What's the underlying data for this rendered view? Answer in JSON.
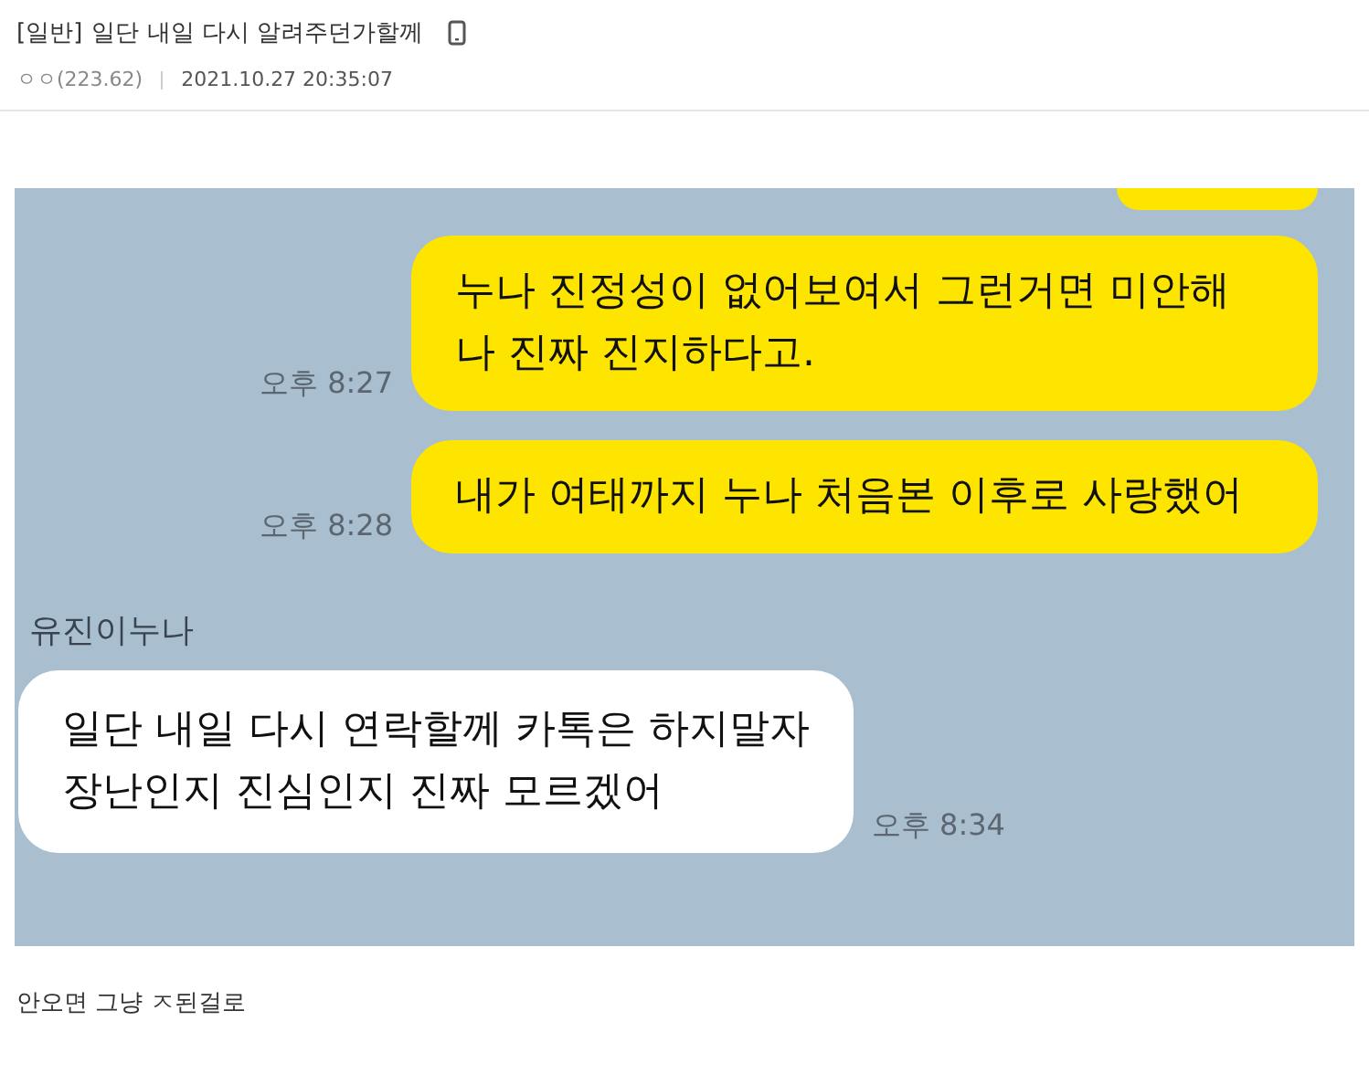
{
  "post": {
    "category": "[일반]",
    "title": "일단 내일 다시 알려주던가할께",
    "author": "ㅇㅇ(223.62)",
    "date": "2021.10.27 20:35:07"
  },
  "chat": {
    "messages": [
      {
        "kind": "partial",
        "mine": true
      },
      {
        "kind": "text",
        "mine": true,
        "lines": [
          "누나 진정성이 없어보여서 그런거면 미안해",
          "나 진짜 진지하다고."
        ],
        "time": "오후 8:27"
      },
      {
        "kind": "text",
        "mine": true,
        "lines": [
          "내가 여태까지 누나 처음본 이후로 사랑했어"
        ],
        "time": "오후 8:28"
      },
      {
        "kind": "sender",
        "name": "유진이누나"
      },
      {
        "kind": "text",
        "mine": false,
        "lines": [
          "일단 내일 다시 연락할께 카톡은 하지말자",
          "장난인지 진심인지 진짜 모르겠어"
        ],
        "time": "오후 8:34"
      }
    ]
  },
  "body": "안오면 그냥 ㅈ된걸로"
}
